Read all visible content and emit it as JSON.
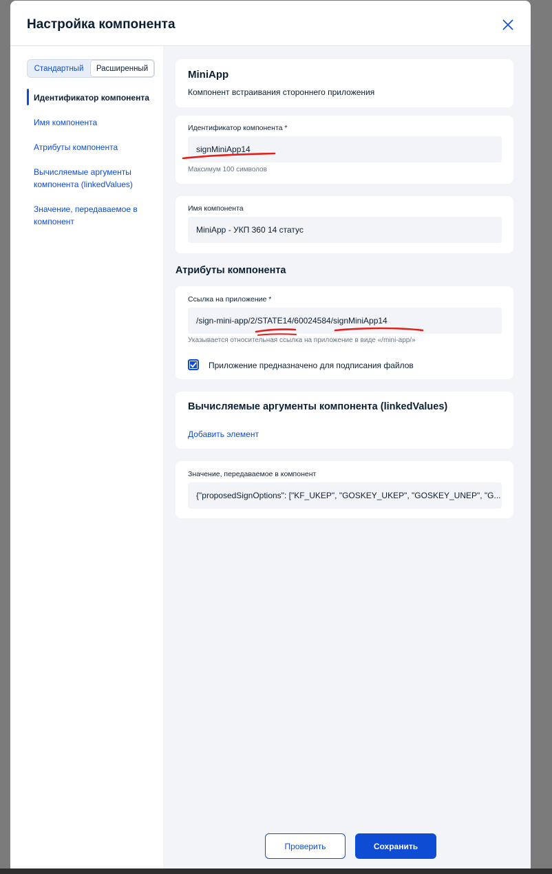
{
  "modal": {
    "title": "Настройка компонента",
    "close_icon": "close-icon"
  },
  "mode_switch": {
    "standard": "Стандартный",
    "advanced": "Расширенный"
  },
  "nav": [
    "Идентификатор компонента",
    "Имя компонента",
    "Атрибуты компонента",
    "Вычисляемые аргументы компонента (linkedValues)",
    "Значение, передаваемое в компонент"
  ],
  "miniapp": {
    "title": "MiniApp",
    "description": "Компонент встраивания стороннего приложения"
  },
  "identifier": {
    "label": "Идентификатор компонента *",
    "value": "signMiniApp14",
    "hint": "Максимум 100 символов"
  },
  "name": {
    "label": "Имя компонента",
    "value": "MiniApp - УКП 360 14 статус"
  },
  "attributes": {
    "heading": "Атрибуты компонента",
    "link_label": "Ссылка на приложение *",
    "link_value": "/sign-mini-app/2/STATE14/60024584/signMiniApp14",
    "link_hint": "Указывается относительная ссылка на приложение в виде «/mini-app/»",
    "checkbox_label": "Приложение предназначено для подписания файлов",
    "checkbox_checked": true
  },
  "linked_values": {
    "heading": "Вычисляемые аргументы компонента (linkedValues)",
    "add_link": "Добавить элемент"
  },
  "passed_value": {
    "label": "Значение, передаваемое в компонент",
    "value": "{\"proposedSignOptions\": [\"KF_UKEP\", \"GOSKEY_UKEP\", \"GOSKEY_UNEP\", \"G..."
  },
  "buttons": {
    "check": "Проверить",
    "save": "Сохранить"
  },
  "colors": {
    "accent": "#0d4cd3",
    "annotation": "#e0201c"
  }
}
